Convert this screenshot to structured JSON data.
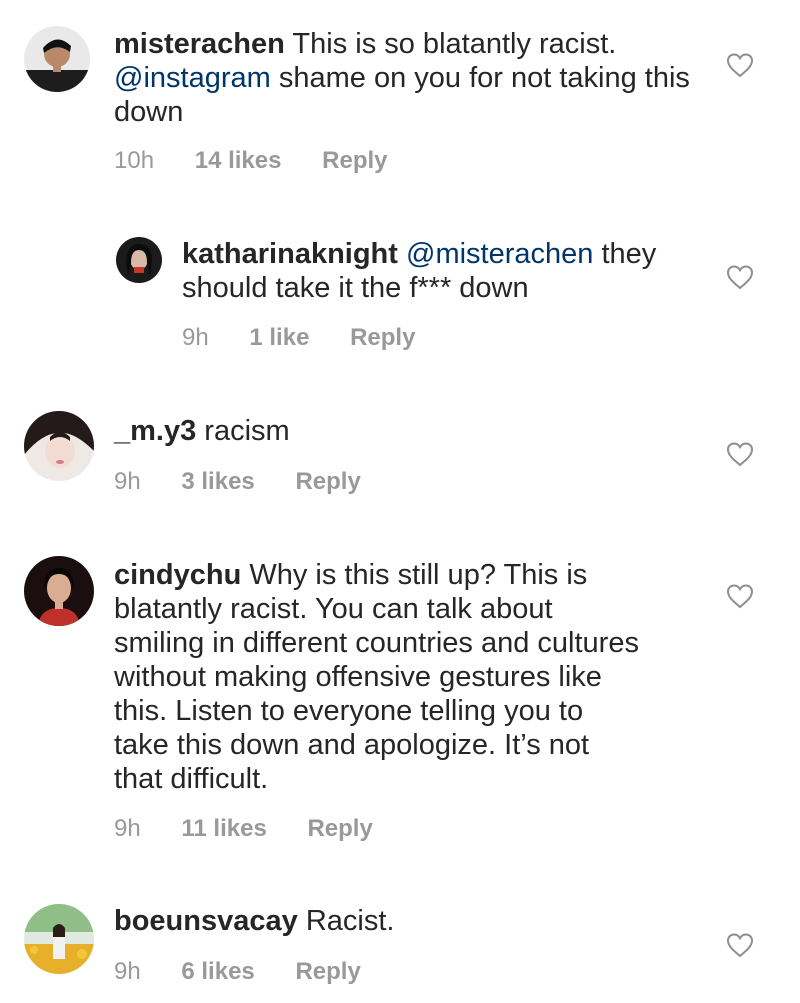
{
  "comments": [
    {
      "username": "misterachen",
      "mention": "",
      "text_parts": [
        "This is so blatantly racist.",
        "@instagram",
        "shame on you for not taking this down"
      ],
      "time": "10h",
      "likes": "14 likes",
      "reply": "Reply"
    },
    {
      "username": "katharinaknight",
      "mention": "@misterachen",
      "text": "they should take it the f*** down",
      "time": "9h",
      "likes": "1 like",
      "reply": "Reply"
    },
    {
      "username": "_m.y3",
      "text": "racism",
      "time": "9h",
      "likes": "3 likes",
      "reply": "Reply"
    },
    {
      "username": "cindychu",
      "text": "Why is this still up? This is blatantly racist. You can talk about smiling in different countries and cultures without making offensive gestures like this. Listen to everyone telling you to take this down and apologize. It’s not that difficult.",
      "time": "9h",
      "likes": "11 likes",
      "reply": "Reply"
    },
    {
      "username": "boeunsvacay",
      "text": "Racist.",
      "time": "9h",
      "likes": "6 likes",
      "reply": "Reply"
    }
  ],
  "icons": {
    "heart": "heart-outline-icon"
  },
  "colors": {
    "text": "#262626",
    "mention": "#003569",
    "meta": "#999999"
  }
}
